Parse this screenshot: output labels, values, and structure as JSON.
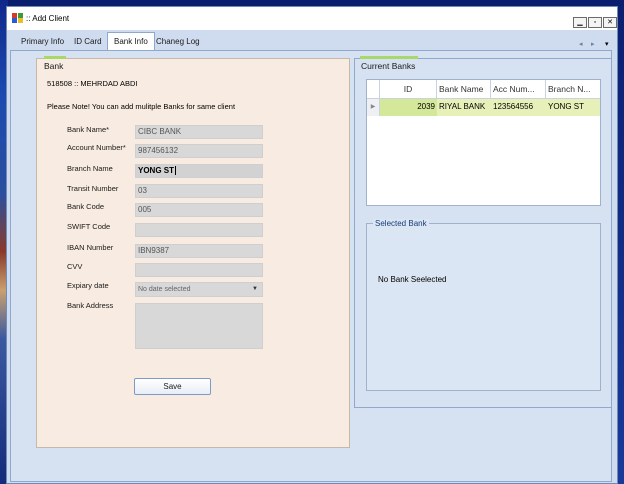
{
  "window": {
    "title": ":: Add Client"
  },
  "window_buttons": {
    "minimize": "▁",
    "maximize": "▫",
    "close": "✕"
  },
  "tabs": [
    {
      "label": "Primary Info"
    },
    {
      "label": "ID Card"
    },
    {
      "label": "Bank Info"
    },
    {
      "label": "Chaneg Log"
    }
  ],
  "tab_nav": {
    "prev": "◂",
    "next": "▸",
    "menu": "▾"
  },
  "bank_panel": {
    "title": "Bank",
    "client": "518508 :: MEHRDAD ABDI",
    "note": "Please Note! You can add mulitple Banks for same client",
    "fields": {
      "bank_name": {
        "label": "Bank Name*",
        "value": "CIBC BANK"
      },
      "account_number": {
        "label": "Account Number*",
        "value": "987456132"
      },
      "branch_name": {
        "label": "Branch Name",
        "value": "YONG ST"
      },
      "transit_number": {
        "label": "Transit Number",
        "value": "03"
      },
      "bank_code": {
        "label": "Bank Code",
        "value": "005"
      },
      "swift_code": {
        "label": "SWIFT Code",
        "value": ""
      },
      "iban_number": {
        "label": "IBAN Number",
        "value": "IBN9387"
      },
      "cvv": {
        "label": "CVV",
        "value": ""
      },
      "expiry_date": {
        "label": "Expiary date",
        "value": "No date selected"
      },
      "bank_address": {
        "label": "Bank Address",
        "value": ""
      }
    },
    "save_label": "Save"
  },
  "current_banks": {
    "title": "Current Banks",
    "columns": [
      "ID",
      "Bank Name",
      "Acc Num...",
      "Branch N..."
    ],
    "rows": [
      {
        "id": "2039",
        "bank_name": "RIYAL BANK",
        "acc_num": "123564556",
        "branch": "YONG ST"
      }
    ]
  },
  "selected_bank": {
    "title": "Selected Bank",
    "message": "No Bank Seelected"
  },
  "colors": {
    "accent_green": "#a8d86a",
    "row_highlight": "#e7f0b8",
    "panel_beige": "#f8ebe1",
    "window_blue": "#cfdcef"
  }
}
